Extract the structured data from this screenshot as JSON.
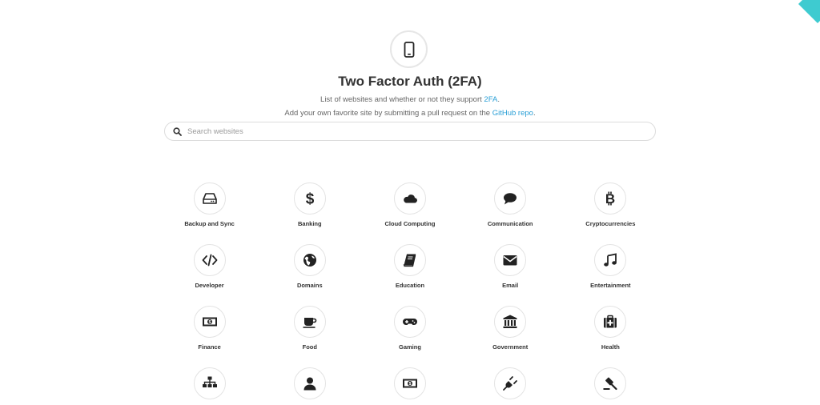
{
  "header": {
    "title": "Two Factor Auth (2FA)",
    "subtitle_line1_text": "List of websites and whether or not they support ",
    "subtitle_line1_link": "2FA",
    "subtitle_line1_end": ".",
    "subtitle_line2_text": "Add your own favorite site by submitting a pull request on the ",
    "subtitle_line2_link": "GitHub repo",
    "subtitle_line2_end": "."
  },
  "search": {
    "placeholder": "Search websites",
    "value": ""
  },
  "categories": [
    {
      "label": "Backup and Sync",
      "icon": "hard-drive-icon"
    },
    {
      "label": "Banking",
      "icon": "dollar-icon"
    },
    {
      "label": "Cloud Computing",
      "icon": "cloud-icon"
    },
    {
      "label": "Communication",
      "icon": "speech-bubble-icon"
    },
    {
      "label": "Cryptocurrencies",
      "icon": "bitcoin-icon"
    },
    {
      "label": "Developer",
      "icon": "code-icon"
    },
    {
      "label": "Domains",
      "icon": "globe-icon"
    },
    {
      "label": "Education",
      "icon": "book-icon"
    },
    {
      "label": "Email",
      "icon": "envelope-icon"
    },
    {
      "label": "Entertainment",
      "icon": "music-note-icon"
    },
    {
      "label": "Finance",
      "icon": "money-bill-icon"
    },
    {
      "label": "Food",
      "icon": "coffee-cup-icon"
    },
    {
      "label": "Gaming",
      "icon": "gamepad-icon"
    },
    {
      "label": "Government",
      "icon": "institution-icon"
    },
    {
      "label": "Health",
      "icon": "medkit-icon"
    },
    {
      "label": "",
      "icon": "sitemap-icon"
    },
    {
      "label": "",
      "icon": "user-icon"
    },
    {
      "label": "",
      "icon": "money-bill-icon"
    },
    {
      "label": "",
      "icon": "plug-icon"
    },
    {
      "label": "",
      "icon": "gavel-icon"
    }
  ],
  "colors": {
    "accent": "#2a9fd6",
    "ribbon": "#3ecbd0",
    "icon": "#222222"
  }
}
